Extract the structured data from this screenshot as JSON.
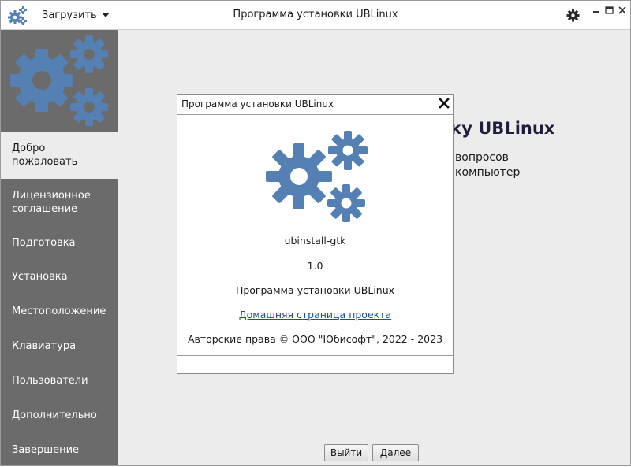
{
  "titlebar": {
    "menu_label": "Загрузить",
    "title": "Программа установки UBLinux",
    "app_icon": "gears-icon",
    "settings_icon": "gear-icon"
  },
  "sidebar": {
    "items": [
      {
        "label": "Добро пожаловать",
        "active": true
      },
      {
        "label": "Лицензионное соглашение",
        "active": false
      },
      {
        "label": "Подготовка",
        "active": false
      },
      {
        "label": "Установка",
        "active": false
      },
      {
        "label": "Местоположение",
        "active": false
      },
      {
        "label": "Клавиатура",
        "active": false
      },
      {
        "label": "Пользователи",
        "active": false
      },
      {
        "label": "Дополнительно",
        "active": false
      },
      {
        "label": "Завершение",
        "active": false
      }
    ]
  },
  "main": {
    "welcome_title_fragment": "ку UBLinux",
    "welcome_line1_fragment": "вопросов",
    "welcome_line2_fragment": "компьютер",
    "exit_label": "Выйти",
    "next_label": "Далее"
  },
  "about_dialog": {
    "title": "Программа установки UBLinux",
    "app_name": "ubinstall-gtk",
    "version": "1.0",
    "description": "Программа установки UBLinux",
    "link_text": "Домашняя страница проекта",
    "copyright": "Авторские права © ООО \"Юбисофт\", 2022 - 2023"
  },
  "colors": {
    "sidebar_bg": "#6b6b6b",
    "gear_blue": "#5580b4",
    "window_bg": "#ececec",
    "link": "#1b4f9a"
  }
}
